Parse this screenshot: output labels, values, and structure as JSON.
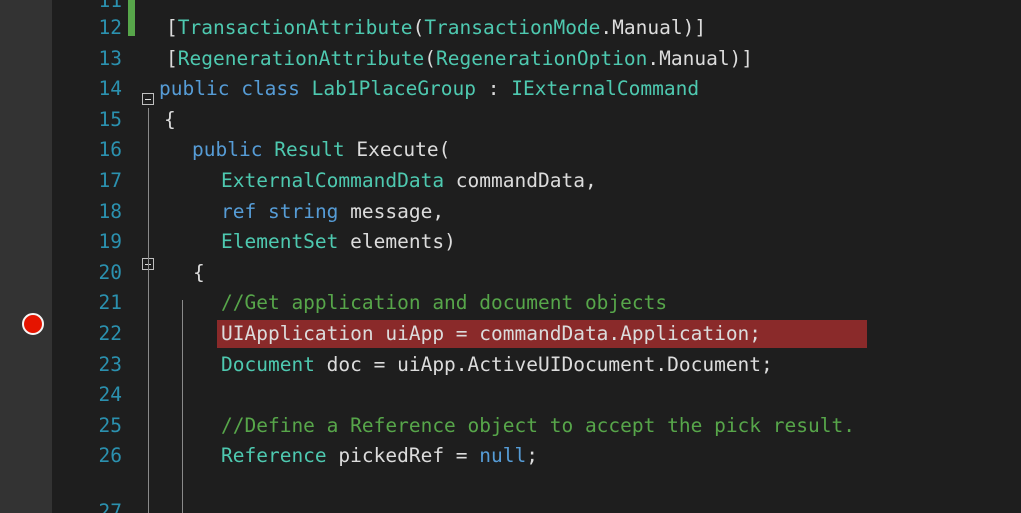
{
  "editor": {
    "colors": {
      "background": "#1e1e1e",
      "line_number": "#2b91af",
      "keyword": "#569cd6",
      "type": "#4ec9b0",
      "comment": "#57a64a",
      "identifier": "#dcdcdc",
      "breakpoint": "#e51400",
      "breakpoint_highlight": "#8a2a2a"
    },
    "partial_top_line_number": "11",
    "partial_bottom_line_number": "27",
    "breakpoint_line": "22",
    "lines": [
      {
        "n": "12",
        "tokens": [
          {
            "c": "tx",
            "t": "["
          },
          {
            "c": "ty",
            "t": "TransactionAttribute"
          },
          {
            "c": "tx",
            "t": "("
          },
          {
            "c": "ty",
            "t": "TransactionMode"
          },
          {
            "c": "tx",
            "t": ".Manual)]"
          }
        ]
      },
      {
        "n": "13",
        "tokens": [
          {
            "c": "tx",
            "t": "["
          },
          {
            "c": "ty",
            "t": "RegenerationAttribute"
          },
          {
            "c": "tx",
            "t": "("
          },
          {
            "c": "ty",
            "t": "RegenerationOption"
          },
          {
            "c": "tx",
            "t": ".Manual)]"
          }
        ]
      },
      {
        "n": "14",
        "tokens": [
          {
            "c": "kw",
            "t": "public"
          },
          {
            "c": "tx",
            "t": " "
          },
          {
            "c": "kw",
            "t": "class"
          },
          {
            "c": "tx",
            "t": " "
          },
          {
            "c": "ty",
            "t": "Lab1PlaceGroup"
          },
          {
            "c": "tx",
            "t": " : "
          },
          {
            "c": "ty",
            "t": "IExternalCommand"
          }
        ]
      },
      {
        "n": "15",
        "tokens": [
          {
            "c": "tx",
            "t": "{"
          }
        ]
      },
      {
        "n": "16",
        "tokens": [
          {
            "c": "kw",
            "t": "public"
          },
          {
            "c": "tx",
            "t": " "
          },
          {
            "c": "ty",
            "t": "Result"
          },
          {
            "c": "tx",
            "t": " Execute("
          }
        ]
      },
      {
        "n": "17",
        "tokens": [
          {
            "c": "ty",
            "t": "ExternalCommandData"
          },
          {
            "c": "tx",
            "t": " commandData,"
          }
        ]
      },
      {
        "n": "18",
        "tokens": [
          {
            "c": "kw",
            "t": "ref"
          },
          {
            "c": "tx",
            "t": " "
          },
          {
            "c": "kw",
            "t": "string"
          },
          {
            "c": "tx",
            "t": " message,"
          }
        ]
      },
      {
        "n": "19",
        "tokens": [
          {
            "c": "ty",
            "t": "ElementSet"
          },
          {
            "c": "tx",
            "t": " elements)"
          }
        ]
      },
      {
        "n": "20",
        "tokens": [
          {
            "c": "tx",
            "t": "{"
          }
        ]
      },
      {
        "n": "21",
        "tokens": [
          {
            "c": "cm",
            "t": "//Get application and document objects"
          }
        ]
      },
      {
        "n": "22",
        "tokens": [
          {
            "c": "tx",
            "t": "UIApplication uiApp = commandData.Application;"
          }
        ]
      },
      {
        "n": "23",
        "tokens": [
          {
            "c": "ty",
            "t": "Document"
          },
          {
            "c": "tx",
            "t": " doc = uiApp.ActiveUIDocument.Document;"
          }
        ]
      },
      {
        "n": "24",
        "tokens": []
      },
      {
        "n": "25",
        "tokens": [
          {
            "c": "cm",
            "t": "//Define a Reference object to accept the pick result."
          }
        ]
      },
      {
        "n": "26",
        "tokens": [
          {
            "c": "ty",
            "t": "Reference"
          },
          {
            "c": "tx",
            "t": " pickedRef = "
          },
          {
            "c": "kw",
            "t": "null"
          },
          {
            "c": "tx",
            "t": ";"
          }
        ]
      }
    ]
  }
}
